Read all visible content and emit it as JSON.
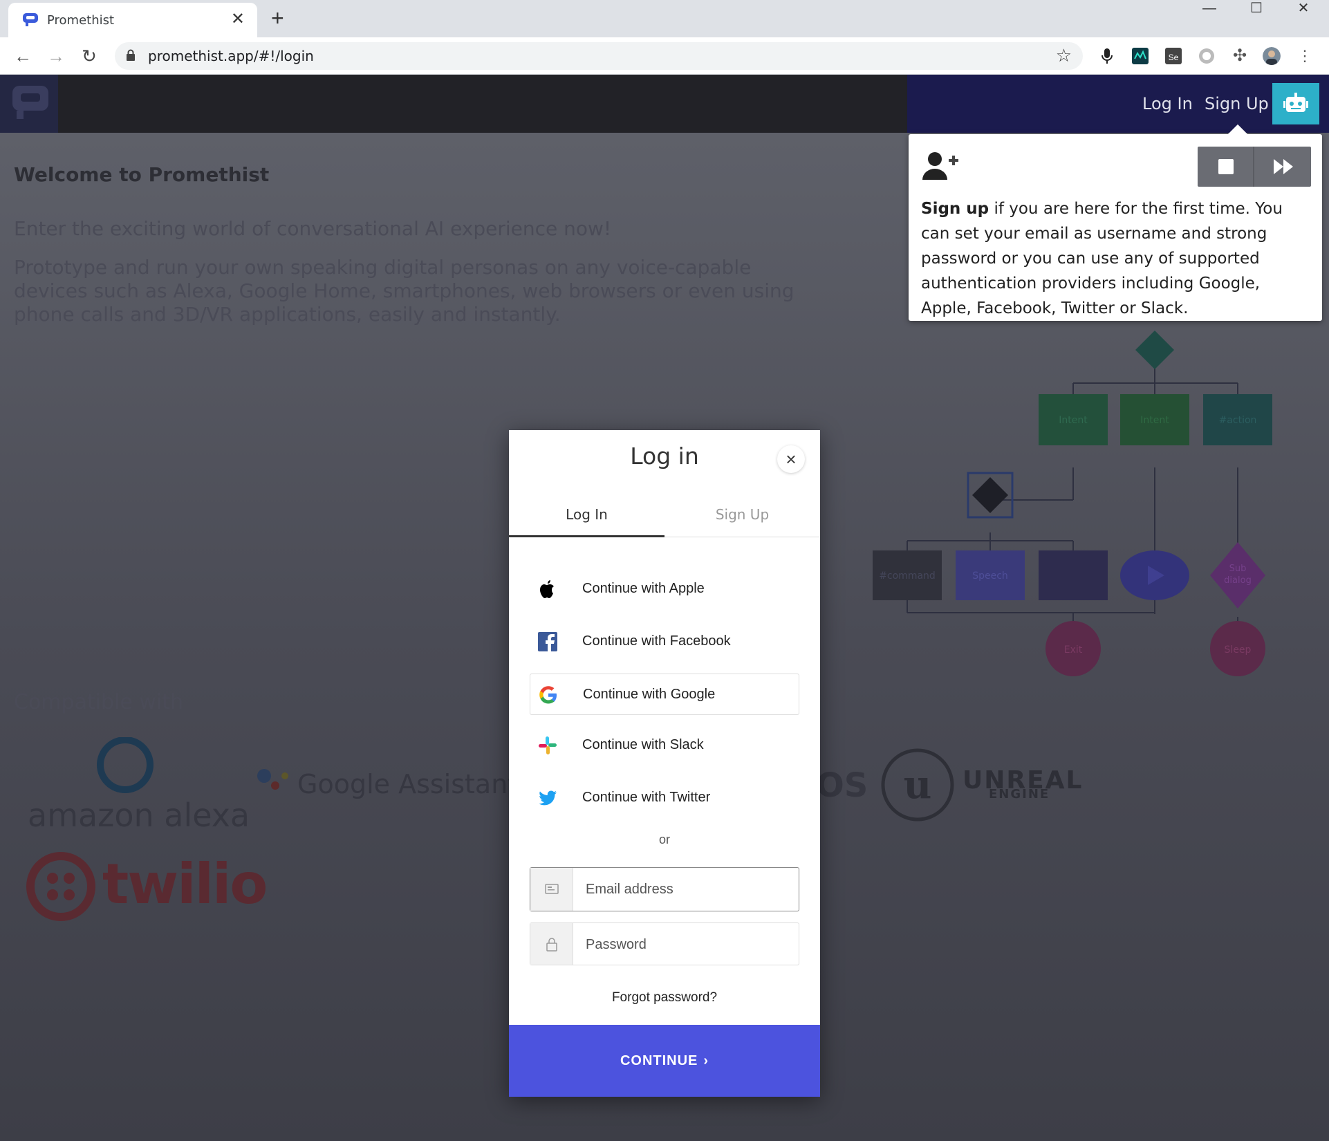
{
  "browser": {
    "tab_title": "Promethist",
    "tab_close": "✕",
    "new_tab": "+",
    "url": "promethist.app/#!/login",
    "window_controls": {
      "minimize": "—",
      "maximize": "☐",
      "close": "✕"
    }
  },
  "app": {
    "nav": {
      "login": "Log In",
      "signup": "Sign Up"
    },
    "welcome_title": "Welcome to Promethist",
    "tagline": "Enter the exciting world of conversational AI experience now!",
    "description": "Prototype and run your own speaking digital personas on any voice-capable devices such as Alexa, Google Home, smartphones, web browsers or even using phone calls and 3D/VR applications, easily and instantly.",
    "compatible_title": "Compatible with",
    "partners": {
      "alexa": "amazon alexa",
      "google": "Google Assistant",
      "ios": "OS",
      "unreal_top": "UNREAL",
      "unreal_bottom": "ENGINE",
      "twilio": "twilio"
    },
    "flow": {
      "intent1": "Intent",
      "intent2": "Intent",
      "action": "#action",
      "command": "#command",
      "speech": "Speech",
      "subdialog_1": "Sub",
      "subdialog_2": "dialog",
      "exit": "Exit",
      "sleep": "Sleep"
    }
  },
  "tooltip": {
    "bold": "Sign up",
    "text": " if you are here for the first time. You can set your email as username and strong password or you can use any of supported authentication providers including Google, Apple, Facebook, Twitter or Slack."
  },
  "modal": {
    "title": "Log in",
    "close": "×",
    "tabs": {
      "login": "Log In",
      "signup": "Sign Up"
    },
    "social": {
      "apple": "Continue with Apple",
      "facebook": "Continue with Facebook",
      "google": "Continue with Google",
      "slack": "Continue with Slack",
      "twitter": "Continue with Twitter"
    },
    "or": "or",
    "email_placeholder": "Email address",
    "password_placeholder": "Password",
    "forgot": "Forgot password?",
    "continue": "CONTINUE"
  },
  "colors": {
    "accent": "#4c53de",
    "bot_button": "#2db0c9",
    "nav_bg": "#1b1b4e"
  }
}
